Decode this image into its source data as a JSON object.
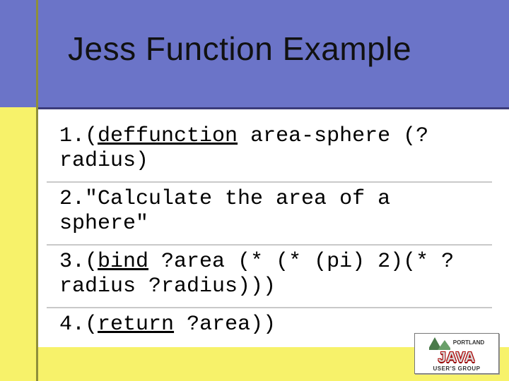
{
  "title": "Jess Function Example",
  "code": {
    "line1_num": "1.",
    "line1_kw": "deffunction",
    "line1_rest_a": "(",
    "line1_rest_b": " area-sphere (?radius)",
    "line2": "2.\"Calculate the area of a sphere\"",
    "line3_num": "3.",
    "line3_a": "(",
    "line3_kw": "bind",
    "line3_b": " ?area (* (* (pi) 2)(* ?radius ?radius)))",
    "line4_num": "4.",
    "line4_a": "(",
    "line4_kw": "return",
    "line4_b": " ?area))"
  },
  "logo": {
    "org_line1": "PORTLAND",
    "java": "JAVA",
    "group": "USER'S GROUP"
  }
}
